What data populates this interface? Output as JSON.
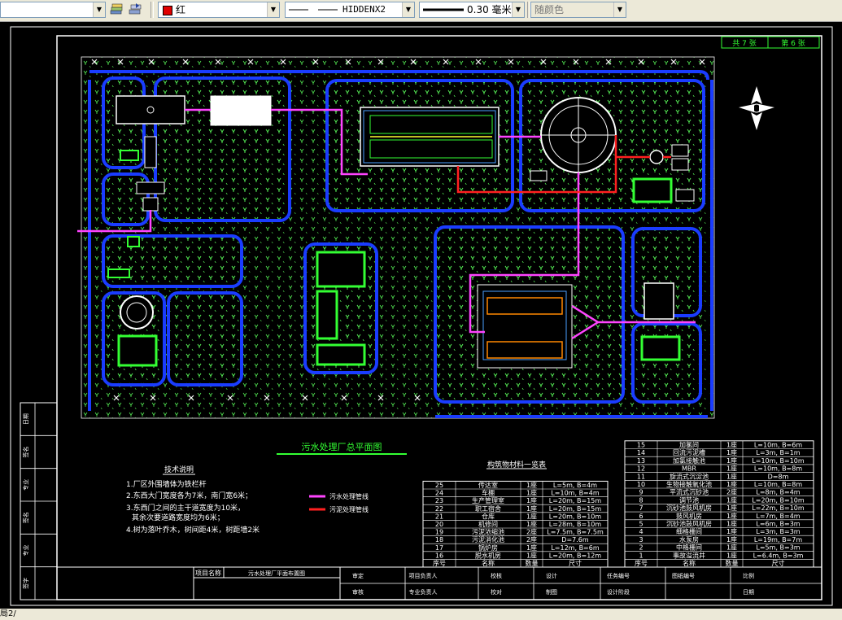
{
  "toolbar": {
    "color_value": "红",
    "linetype_value": "HIDDENX2",
    "lineweight_value": "0.30 毫米",
    "plotstyle_value": "随颜色",
    "color_swatch": "#e00000"
  },
  "drawing": {
    "sheet_tags": [
      "共 7 张",
      "第 6 张"
    ],
    "title": "污水处理厂总平面图",
    "notes_title": "技术说明",
    "notes": [
      "1.厂区外围墙体为铁栏杆",
      "2.东西大门宽度各为7米，南门宽6米；",
      "3.东西门之间的主干道宽度为10米，",
      "其余次要道路宽度均为6米；",
      "4.树为落叶乔木，树间距4米，树距墙2米"
    ],
    "legend": [
      {
        "label": "污水处理管线",
        "color": "#ff44ff"
      },
      {
        "label": "污泥处理管线",
        "color": "#ff2020"
      }
    ],
    "table_title": "构筑物材料一览表",
    "table_left": {
      "rows": [
        [
          "25",
          "传达室",
          "1座",
          "L=5m, B=4m"
        ],
        [
          "24",
          "车棚",
          "1座",
          "L=10m, B=4m"
        ],
        [
          "23",
          "生产管理室",
          "1座",
          "L=20m, B=15m"
        ],
        [
          "22",
          "职工宿舍",
          "1座",
          "L=20m, B=15m"
        ],
        [
          "21",
          "仓库",
          "1座",
          "L=20m, B=10m"
        ],
        [
          "20",
          "机修间",
          "1座",
          "L=28m, B=10m"
        ],
        [
          "19",
          "污泥浓缩池",
          "2座",
          "L=7.5m, B=7.5m"
        ],
        [
          "18",
          "污泥消化池",
          "2座",
          "D=7.6m"
        ],
        [
          "17",
          "锅炉房",
          "1座",
          "L=12m, B=6m"
        ],
        [
          "16",
          "脱水机房",
          "1座",
          "L=20m, B=12m"
        ]
      ],
      "header": [
        "序号",
        "名称",
        "数量",
        "尺寸"
      ]
    },
    "table_right": {
      "rows": [
        [
          "15",
          "加氯间",
          "1座",
          "L=10m, B=6m"
        ],
        [
          "14",
          "回流污泥槽",
          "1座",
          "L=3m, B=1m"
        ],
        [
          "13",
          "加氯接触池",
          "1座",
          "L=10m, B=10m"
        ],
        [
          "12",
          "MBR",
          "1座",
          "L=10m, B=8m"
        ],
        [
          "11",
          "旋流式沉淀池",
          "1座",
          "D=8m"
        ],
        [
          "10",
          "生物接触氧化池",
          "1座",
          "L=10m, B=8m"
        ],
        [
          "9",
          "平流式沉砂池",
          "2座",
          "L=8m, B=4m"
        ],
        [
          "8",
          "调节池",
          "1座",
          "L=20m, B=10m"
        ],
        [
          "7",
          "沉砂池鼓风机房",
          "1座",
          "L=22m, B=10m"
        ],
        [
          "6",
          "鼓风机房",
          "1座",
          "L=7m, B=4m"
        ],
        [
          "5",
          "沉砂池鼓风机房",
          "1座",
          "L=6m, B=3m"
        ],
        [
          "4",
          "细格栅间",
          "1座",
          "L=3m, B=3m"
        ],
        [
          "3",
          "水泵房",
          "1座",
          "L=19m, B=7m"
        ],
        [
          "2",
          "中格栅间",
          "1座",
          "L=5m, B=3m"
        ],
        [
          "1",
          "事故溢流井",
          "1座",
          "L=6.4m, B=3m"
        ]
      ],
      "header": [
        "序号",
        "名称",
        "数量",
        "尺寸"
      ]
    },
    "title_block": {
      "project_label": "项目名称",
      "project_name": "污水处理厂平面布置图",
      "cells_row1": [
        "审定",
        "项目负责人",
        "校核",
        "设计",
        "任务编号",
        "图纸编号",
        "比例"
      ],
      "cells_row2": [
        "审核",
        "专业负责人",
        "校对",
        "制图",
        "设计阶段",
        "",
        "日期"
      ]
    },
    "side_strip": [
      "日期",
      "签名",
      "专业",
      "签名",
      "专业",
      "签字"
    ]
  },
  "status": {
    "text": "局2/"
  }
}
